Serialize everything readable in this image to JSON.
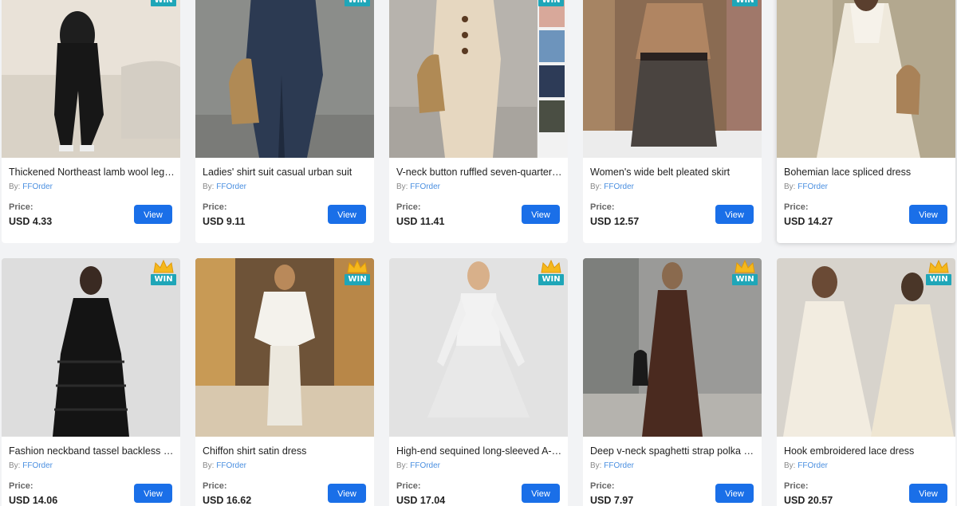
{
  "labels": {
    "by_prefix": "By:",
    "price_label": "Price:",
    "view_button": "View",
    "badge": "WIN"
  },
  "colors": {
    "button_bg": "#1a6fe8",
    "badge_bg": "#1fa6b8",
    "crown": "#f5b81c",
    "seller_link": "#4a8fe0"
  },
  "products": [
    {
      "title": "Thickened Northeast lamb wool leggi...",
      "seller": "FFOrder",
      "price": "USD 4.33",
      "badge": true,
      "image": "black-leggings"
    },
    {
      "title": "Ladies' shirt suit casual urban suit",
      "seller": "FFOrder",
      "price": "USD 9.11",
      "badge": true,
      "image": "navy-linen-suit"
    },
    {
      "title": "V-neck button ruffled seven-quarter ...",
      "seller": "FFOrder",
      "price": "USD 11.41",
      "badge": true,
      "image": "beige-button-set"
    },
    {
      "title": "Women's wide belt pleated skirt",
      "seller": "FFOrder",
      "price": "USD 12.57",
      "badge": true,
      "image": "brown-coat-skirt"
    },
    {
      "title": "Bohemian lace spliced dress",
      "seller": "FFOrder",
      "price": "USD 14.27",
      "badge": false,
      "image": "white-boho-dress"
    },
    {
      "title": "Fashion neckband tassel backless slit ...",
      "seller": "FFOrder",
      "price": "USD 14.06",
      "badge": true,
      "image": "black-tassel-dress"
    },
    {
      "title": "Chiffon shirt satin dress",
      "seller": "FFOrder",
      "price": "USD 16.62",
      "badge": true,
      "image": "white-satin-dress"
    },
    {
      "title": "High-end sequined long-sleeved A-li...",
      "seller": "FFOrder",
      "price": "USD 17.04",
      "badge": true,
      "image": "sequin-mini-dress"
    },
    {
      "title": "Deep v-neck spaghetti strap polka do...",
      "seller": "FFOrder",
      "price": "USD 7.97",
      "badge": true,
      "image": "polka-dot-dress"
    },
    {
      "title": "Hook embroidered lace dress",
      "seller": "FFOrder",
      "price": "USD 20.57",
      "badge": true,
      "image": "cream-lace-dress"
    }
  ]
}
